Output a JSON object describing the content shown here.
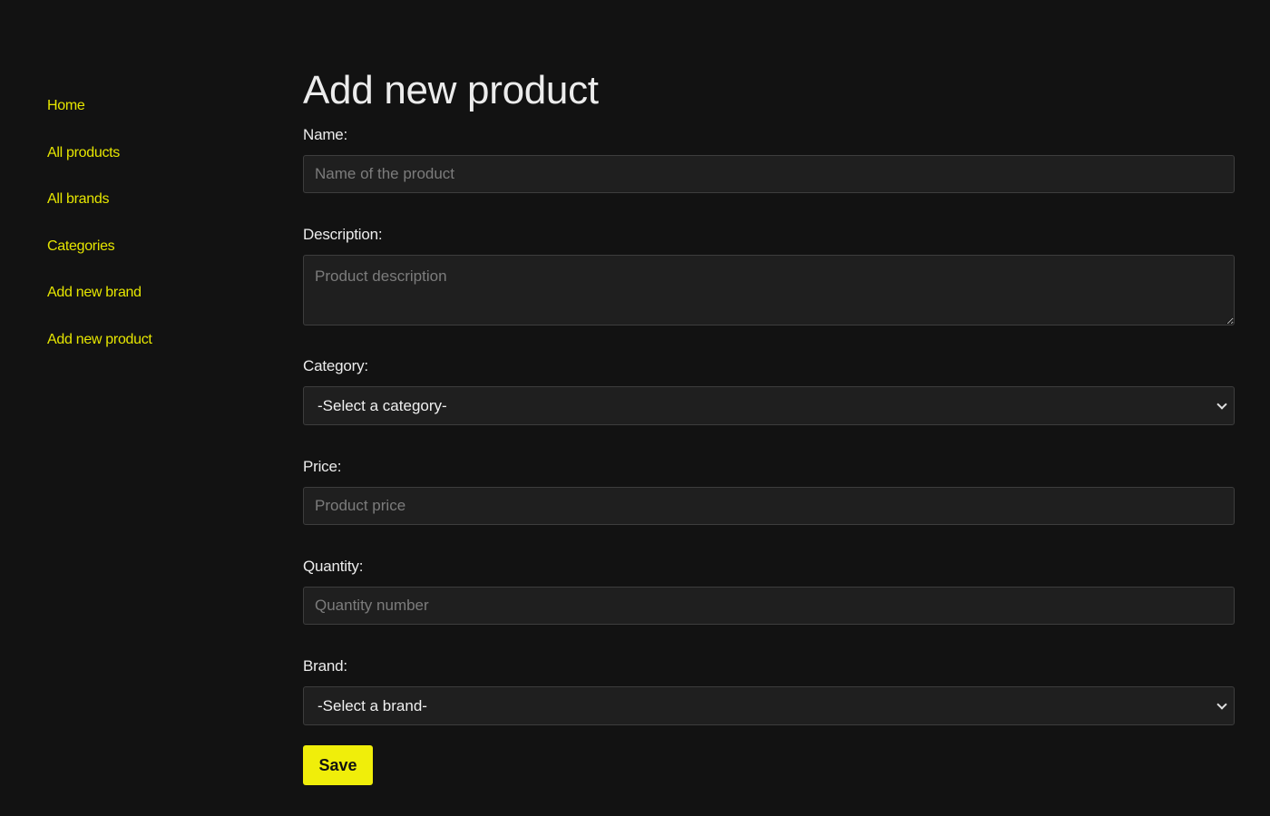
{
  "colors": {
    "background": "#121212",
    "accent": "#f0ee0a",
    "nav_link": "#e6e600",
    "input_background": "#1f1f1f"
  },
  "sidebar": {
    "items": [
      {
        "label": "Home"
      },
      {
        "label": "All products"
      },
      {
        "label": "All brands"
      },
      {
        "label": "Categories"
      },
      {
        "label": "Add new brand"
      },
      {
        "label": "Add new product"
      }
    ]
  },
  "form": {
    "title": "Add new product",
    "name": {
      "label": "Name:",
      "placeholder": "Name of the product",
      "value": ""
    },
    "description": {
      "label": "Description:",
      "placeholder": "Product description",
      "value": ""
    },
    "category": {
      "label": "Category:",
      "selected": "-Select a category-"
    },
    "price": {
      "label": "Price:",
      "placeholder": "Product price",
      "value": ""
    },
    "quantity": {
      "label": "Quantity:",
      "placeholder": "Quantity number",
      "value": ""
    },
    "brand": {
      "label": "Brand:",
      "selected": "-Select a brand-"
    },
    "save_label": "Save"
  },
  "icons": {
    "select_chevron": "chevron-down-icon"
  }
}
